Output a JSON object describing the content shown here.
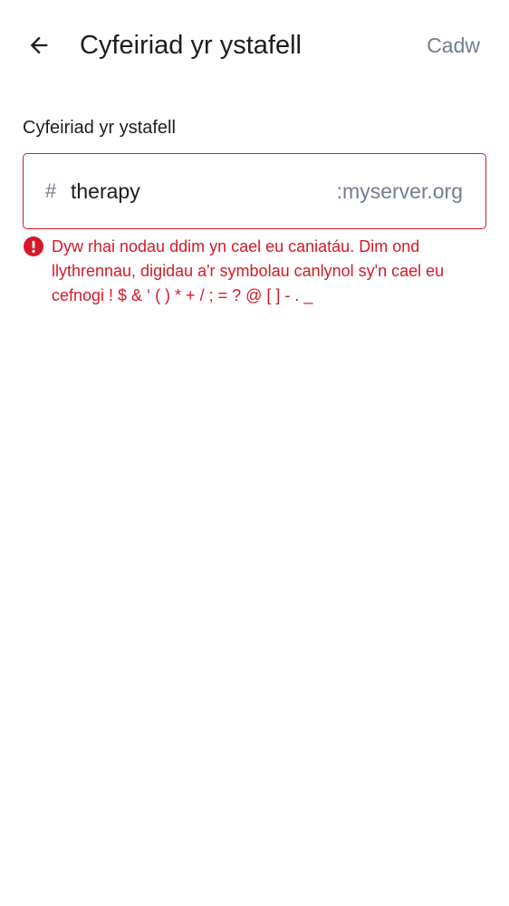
{
  "header": {
    "back_icon": "arrow-left-icon",
    "title": "Cyfeiriad yr ystafell",
    "save_label": "Cadw"
  },
  "field": {
    "label": "Cyfeiriad yr ystafell",
    "prefix": "#",
    "value": "therapy",
    "suffix": ":myserver.org"
  },
  "error": {
    "icon": "error-icon",
    "message": "Dyw rhai nodau ddim yn cael eu caniatáu. Dim ond llythrennau, digidau a'r symbolau canlynol sy'n cael eu cefnogi ! $ & ‘ ( ) * + / ; = ? @ [ ] - . _"
  },
  "colors": {
    "error": "#d51928",
    "secondary_text": "#737d8c",
    "primary_text": "#1b1d21",
    "background": "#ffffff"
  }
}
